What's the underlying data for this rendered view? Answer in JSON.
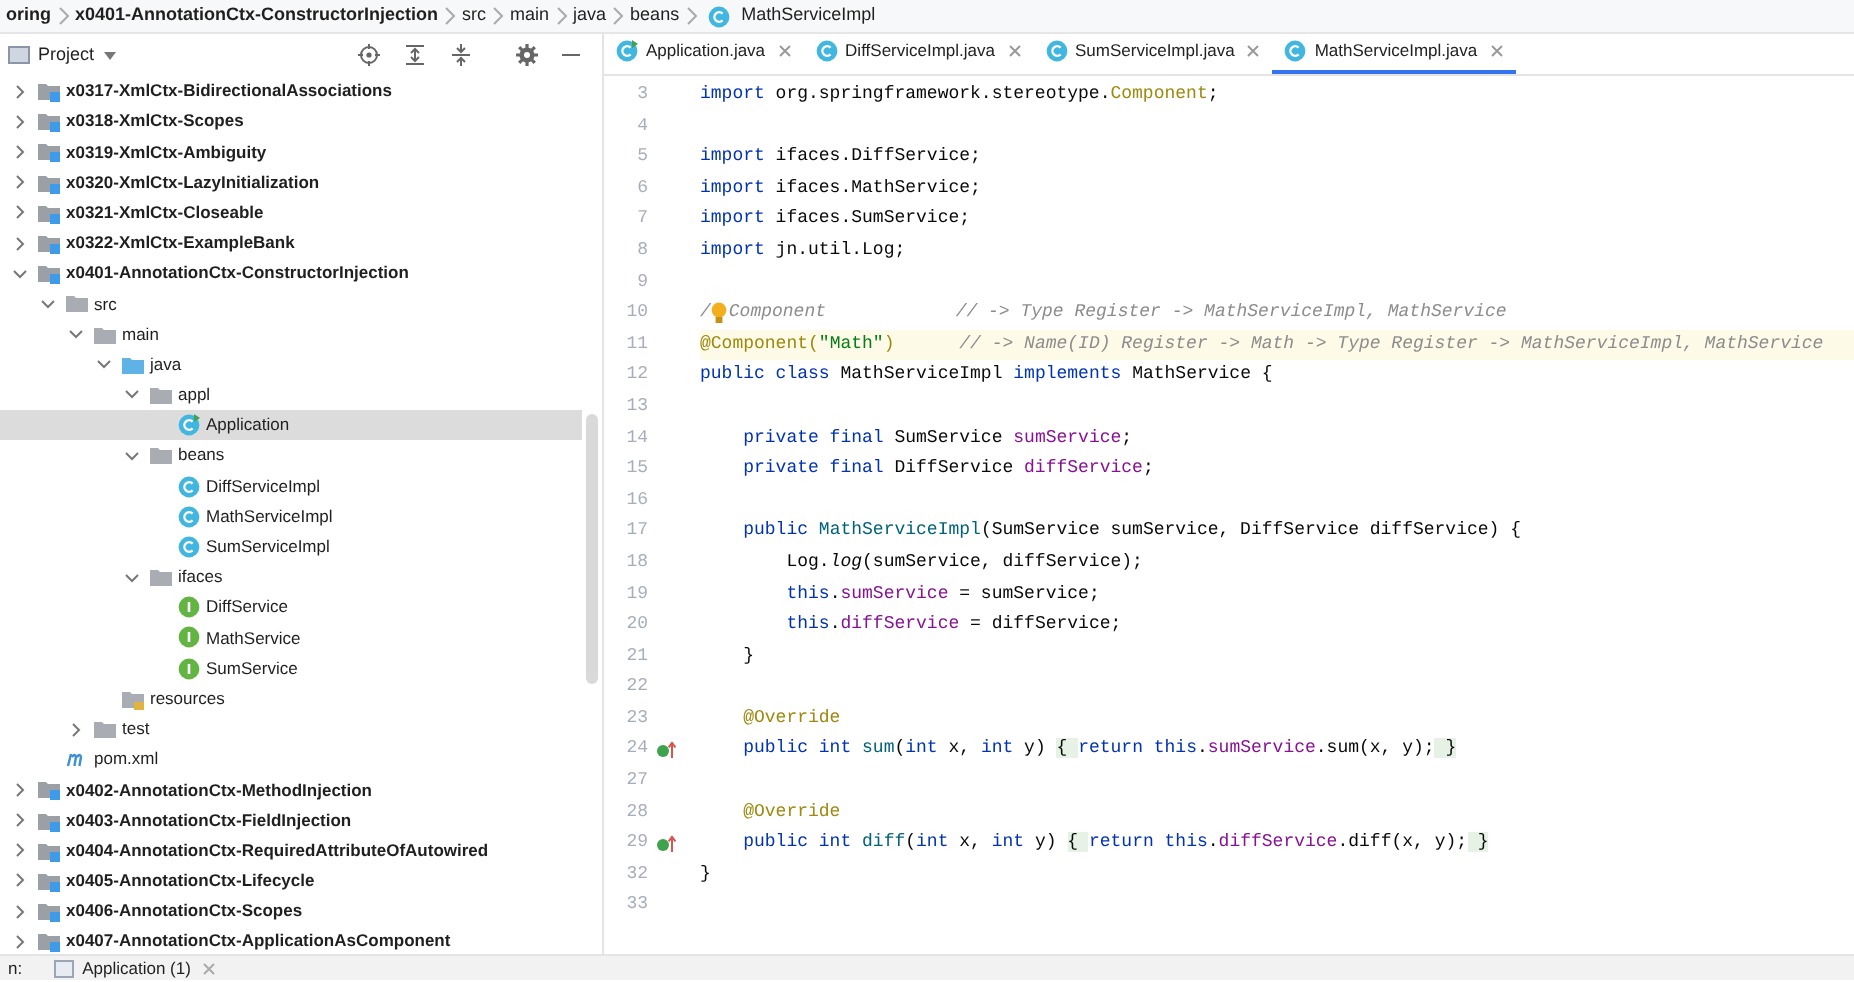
{
  "breadcrumb": [
    {
      "label": "oring",
      "kind": "project"
    },
    {
      "label": "x0401-AnnotationCtx-ConstructorInjection",
      "kind": "module"
    },
    {
      "label": "src",
      "kind": "folder"
    },
    {
      "label": "main",
      "kind": "folder"
    },
    {
      "label": "java",
      "kind": "folder"
    },
    {
      "label": "beans",
      "kind": "folder"
    },
    {
      "label": "MathServiceImpl",
      "kind": "class"
    }
  ],
  "project_panel": {
    "title": "Project",
    "tree": [
      {
        "label": "x0317-XmlCtx-BidirectionalAssociations",
        "kind": "module",
        "expanded": false,
        "selected": false
      },
      {
        "label": "x0318-XmlCtx-Scopes",
        "kind": "module",
        "expanded": false,
        "selected": false
      },
      {
        "label": "x0319-XmlCtx-Ambiguity",
        "kind": "module",
        "expanded": false,
        "selected": false
      },
      {
        "label": "x0320-XmlCtx-LazyInitialization",
        "kind": "module",
        "expanded": false,
        "selected": false
      },
      {
        "label": "x0321-XmlCtx-Closeable",
        "kind": "module",
        "expanded": false,
        "selected": false
      },
      {
        "label": "x0322-XmlCtx-ExampleBank",
        "kind": "module",
        "expanded": false,
        "selected": false
      },
      {
        "label": "x0401-AnnotationCtx-ConstructorInjection",
        "kind": "module",
        "expanded": true,
        "selected": false,
        "children": [
          {
            "label": "src",
            "kind": "folder",
            "expanded": true,
            "selected": false,
            "children": [
              {
                "label": "main",
                "kind": "folder",
                "expanded": true,
                "selected": false,
                "children": [
                  {
                    "label": "java",
                    "kind": "source-folder",
                    "expanded": true,
                    "selected": false,
                    "children": [
                      {
                        "label": "appl",
                        "kind": "package",
                        "expanded": true,
                        "selected": false,
                        "children": [
                          {
                            "label": "Application",
                            "kind": "main-class",
                            "selected": true
                          }
                        ]
                      },
                      {
                        "label": "beans",
                        "kind": "package",
                        "expanded": true,
                        "selected": false,
                        "children": [
                          {
                            "label": "DiffServiceImpl",
                            "kind": "class",
                            "selected": false
                          },
                          {
                            "label": "MathServiceImpl",
                            "kind": "class",
                            "selected": false
                          },
                          {
                            "label": "SumServiceImpl",
                            "kind": "class",
                            "selected": false
                          }
                        ]
                      },
                      {
                        "label": "ifaces",
                        "kind": "package",
                        "expanded": true,
                        "selected": false,
                        "children": [
                          {
                            "label": "DiffService",
                            "kind": "interface",
                            "selected": false
                          },
                          {
                            "label": "MathService",
                            "kind": "interface",
                            "selected": false
                          },
                          {
                            "label": "SumService",
                            "kind": "interface",
                            "selected": false
                          }
                        ]
                      }
                    ]
                  },
                  {
                    "label": "resources",
                    "kind": "resources-folder",
                    "selected": false
                  }
                ]
              },
              {
                "label": "test",
                "kind": "folder",
                "expanded": false,
                "selected": false
              }
            ]
          },
          {
            "label": "pom.xml",
            "kind": "pom",
            "selected": false
          }
        ]
      },
      {
        "label": "x0402-AnnotationCtx-MethodInjection",
        "kind": "module",
        "expanded": false,
        "selected": false
      },
      {
        "label": "x0403-AnnotationCtx-FieldInjection",
        "kind": "module",
        "expanded": false,
        "selected": false
      },
      {
        "label": "x0404-AnnotationCtx-RequiredAttributeOfAutowired",
        "kind": "module",
        "expanded": false,
        "selected": false
      },
      {
        "label": "x0405-AnnotationCtx-Lifecycle",
        "kind": "module",
        "expanded": false,
        "selected": false
      },
      {
        "label": "x0406-AnnotationCtx-Scopes",
        "kind": "module",
        "expanded": false,
        "selected": false
      },
      {
        "label": "x0407-AnnotationCtx-ApplicationAsComponent",
        "kind": "module",
        "expanded": false,
        "selected": false
      }
    ]
  },
  "editor": {
    "tabs": [
      {
        "label": "Application.java",
        "kind": "main-class",
        "selected": false
      },
      {
        "label": "DiffServiceImpl.java",
        "kind": "class",
        "selected": false
      },
      {
        "label": "SumServiceImpl.java",
        "kind": "class",
        "selected": false
      },
      {
        "label": "MathServiceImpl.java",
        "kind": "class",
        "selected": true
      }
    ],
    "lines": [
      {
        "number": "3",
        "kind": "normal",
        "tokens": [
          {
            "kind": "keyword",
            "text": "import"
          },
          {
            "kind": "plain",
            "text": " org.springframework.stereotype."
          },
          {
            "kind": "annotation",
            "text": "Component"
          },
          {
            "kind": "plain",
            "text": ";"
          }
        ]
      },
      {
        "number": "4",
        "kind": "normal"
      },
      {
        "number": "5",
        "kind": "normal",
        "tokens": [
          {
            "kind": "keyword",
            "text": "import"
          },
          {
            "kind": "plain",
            "text": " ifaces.DiffService;"
          }
        ]
      },
      {
        "number": "6",
        "kind": "normal",
        "tokens": [
          {
            "kind": "keyword",
            "text": "import"
          },
          {
            "kind": "plain",
            "text": " ifaces.MathService;"
          }
        ]
      },
      {
        "number": "7",
        "kind": "normal",
        "tokens": [
          {
            "kind": "keyword",
            "text": "import"
          },
          {
            "kind": "plain",
            "text": " ifaces.SumService;"
          }
        ]
      },
      {
        "number": "8",
        "kind": "normal",
        "tokens": [
          {
            "kind": "keyword",
            "text": "import"
          },
          {
            "kind": "plain",
            "text": " jn.util.Log;"
          }
        ]
      },
      {
        "number": "9",
        "kind": "normal"
      },
      {
        "number": "10",
        "kind": "normal",
        "tokens": [
          {
            "kind": "comment",
            "text": "/"
          },
          {
            "kind": "bulb"
          },
          {
            "kind": "comment",
            "text": "Component            // -> Type Register -> MathServiceImpl, MathService"
          }
        ]
      },
      {
        "number": "11",
        "kind": "current",
        "tokens": [
          {
            "kind": "annotation",
            "text": "@Component("
          },
          {
            "kind": "string",
            "text": "\"Math\""
          },
          {
            "kind": "annotation",
            "text": ")"
          },
          {
            "kind": "comment",
            "text": "      // -> Name(ID) Register -> Math -> Type Register -> MathServiceImpl, MathService"
          }
        ]
      },
      {
        "number": "12",
        "kind": "normal",
        "tokens": [
          {
            "kind": "keyword",
            "text": "public class "
          },
          {
            "kind": "plain",
            "text": "MathServiceImpl "
          },
          {
            "kind": "keyword",
            "text": "implements "
          },
          {
            "kind": "plain",
            "text": "MathService {"
          }
        ]
      },
      {
        "number": "13",
        "kind": "normal"
      },
      {
        "number": "14",
        "kind": "normal",
        "tokens": [
          {
            "kind": "keyword",
            "text": "    private final "
          },
          {
            "kind": "plain",
            "text": "SumService "
          },
          {
            "kind": "field",
            "text": "sumService"
          },
          {
            "kind": "plain",
            "text": ";"
          }
        ]
      },
      {
        "number": "15",
        "kind": "normal",
        "tokens": [
          {
            "kind": "keyword",
            "text": "    private final "
          },
          {
            "kind": "plain",
            "text": "DiffService "
          },
          {
            "kind": "field",
            "text": "diffService"
          },
          {
            "kind": "plain",
            "text": ";"
          }
        ]
      },
      {
        "number": "16",
        "kind": "normal"
      },
      {
        "number": "17",
        "kind": "normal",
        "tokens": [
          {
            "kind": "keyword",
            "text": "    public "
          },
          {
            "kind": "method",
            "text": "MathServiceImpl"
          },
          {
            "kind": "plain",
            "text": "(SumService sumService, DiffService diffService) {"
          }
        ]
      },
      {
        "number": "18",
        "kind": "normal",
        "tokens": [
          {
            "kind": "plain",
            "text": "        Log."
          },
          {
            "kind": "static",
            "text": "log"
          },
          {
            "kind": "plain",
            "text": "(sumService, diffService);"
          }
        ]
      },
      {
        "number": "19",
        "kind": "normal",
        "tokens": [
          {
            "kind": "keyword",
            "text": "        this"
          },
          {
            "kind": "plain",
            "text": "."
          },
          {
            "kind": "field",
            "text": "sumService"
          },
          {
            "kind": "plain",
            "text": " = sumService;"
          }
        ]
      },
      {
        "number": "20",
        "kind": "normal",
        "tokens": [
          {
            "kind": "keyword",
            "text": "        this"
          },
          {
            "kind": "plain",
            "text": "."
          },
          {
            "kind": "field",
            "text": "diffService"
          },
          {
            "kind": "plain",
            "text": " = diffService;"
          }
        ]
      },
      {
        "number": "21",
        "kind": "normal",
        "tokens": [
          {
            "kind": "plain",
            "text": "    }"
          }
        ]
      },
      {
        "number": "22",
        "kind": "normal"
      },
      {
        "number": "23",
        "kind": "normal",
        "tokens": [
          {
            "kind": "annotation",
            "text": "    @Override"
          }
        ]
      },
      {
        "number": "24",
        "kind": "override",
        "tokens": [
          {
            "kind": "keyword",
            "text": "    public int "
          },
          {
            "kind": "method",
            "text": "sum"
          },
          {
            "kind": "plain",
            "text": "("
          },
          {
            "kind": "keyword",
            "text": "int"
          },
          {
            "kind": "plain",
            "text": " x, "
          },
          {
            "kind": "keyword",
            "text": "int"
          },
          {
            "kind": "plain",
            "text": " y) "
          },
          {
            "kind": "fold",
            "text": "{ "
          },
          {
            "kind": "keyword",
            "text": "return this"
          },
          {
            "kind": "plain",
            "text": "."
          },
          {
            "kind": "field",
            "text": "sumService"
          },
          {
            "kind": "plain",
            "text": ".sum(x, y);"
          },
          {
            "kind": "fold",
            "text": " }"
          }
        ]
      },
      {
        "number": "27",
        "kind": "normal"
      },
      {
        "number": "28",
        "kind": "normal",
        "tokens": [
          {
            "kind": "annotation",
            "text": "    @Override"
          }
        ]
      },
      {
        "number": "29",
        "kind": "override",
        "tokens": [
          {
            "kind": "keyword",
            "text": "    public int "
          },
          {
            "kind": "method",
            "text": "diff"
          },
          {
            "kind": "plain",
            "text": "("
          },
          {
            "kind": "keyword",
            "text": "int"
          },
          {
            "kind": "plain",
            "text": " x, "
          },
          {
            "kind": "keyword",
            "text": "int"
          },
          {
            "kind": "plain",
            "text": " y) "
          },
          {
            "kind": "fold",
            "text": "{ "
          },
          {
            "kind": "keyword",
            "text": "return this"
          },
          {
            "kind": "plain",
            "text": "."
          },
          {
            "kind": "field",
            "text": "diffService"
          },
          {
            "kind": "plain",
            "text": ".diff(x, y);"
          },
          {
            "kind": "fold",
            "text": " }"
          }
        ]
      },
      {
        "number": "32",
        "kind": "normal",
        "tokens": [
          {
            "kind": "plain",
            "text": "}"
          }
        ]
      },
      {
        "number": "33",
        "kind": "normal"
      }
    ]
  },
  "run_bar": {
    "label": "n:",
    "tab": "Application (1)"
  }
}
